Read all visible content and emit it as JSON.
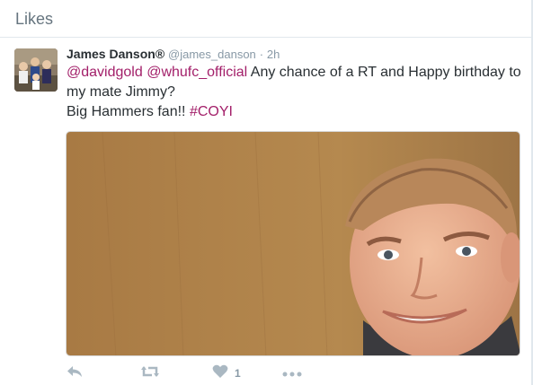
{
  "header": {
    "title": "Likes"
  },
  "tweet": {
    "fullname": "James Danson®",
    "username": "@james_danson",
    "separator": "·",
    "time": "2h",
    "mention1": "@davidgold",
    "mention2": "@whufc_official",
    "text_part1": " Any chance of a RT and Happy birthday to my mate Jimmy?",
    "text_line2": "Big Hammers fan!! ",
    "hashtag": "#COYI",
    "like_count": "1"
  },
  "icons": {
    "reply": "reply-icon",
    "retweet": "retweet-icon",
    "like": "heart-icon",
    "more": "more-icon"
  },
  "colors": {
    "link": "#a3206a",
    "muted": "#8899a6",
    "text": "#292f33",
    "border": "#e1e8ed"
  }
}
